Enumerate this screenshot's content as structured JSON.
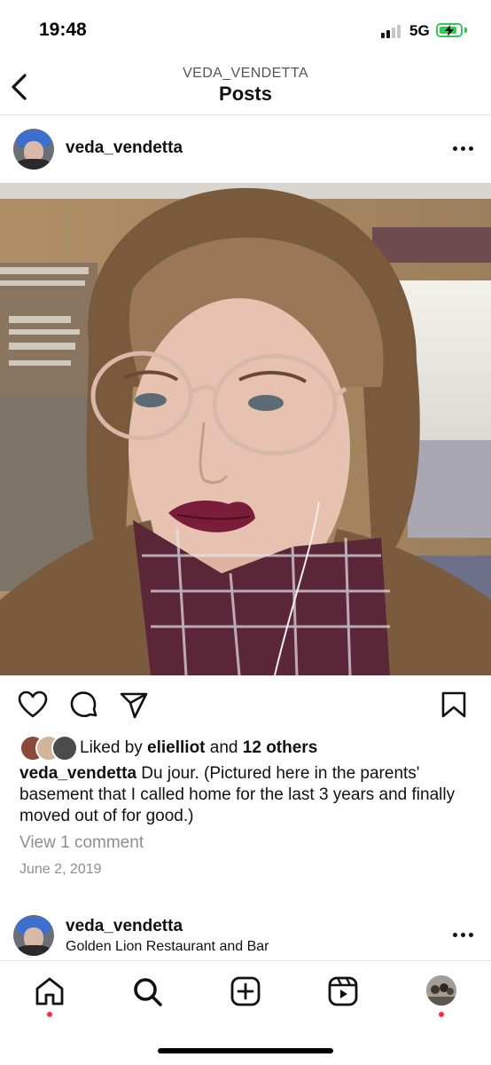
{
  "status_bar": {
    "time": "19:48",
    "network": "5G",
    "signal_bars_active": 2,
    "signal_bars_total": 4,
    "battery_level": 0.85,
    "battery_color": "#35c759"
  },
  "header": {
    "account": "VEDA_VENDETTA",
    "title": "Posts",
    "back_icon": "chevron-left-icon"
  },
  "post": {
    "username": "veda_vendetta",
    "more_icon": "more-horizontal-icon",
    "actions": [
      "heart-icon",
      "comment-icon",
      "share-icon",
      "bookmark-icon"
    ],
    "likes": {
      "prefix": "Liked by ",
      "first_user": "elielliot",
      "joiner": " and ",
      "others": "12 others"
    },
    "caption_user": "veda_vendetta",
    "caption_text": " Du jour. (Pictured here in the parents' basement that I called home for the last 3 years and finally moved out of for good.)",
    "view_comments": "View 1 comment",
    "date": "June 2, 2019"
  },
  "next_post": {
    "username": "veda_vendetta",
    "location": "Golden Lion Restaurant and Bar"
  },
  "bottom_nav": {
    "items": [
      "home-icon",
      "search-icon",
      "new-post-icon",
      "reels-icon",
      "profile-avatar"
    ],
    "notification_color": "#ff2a4a"
  }
}
